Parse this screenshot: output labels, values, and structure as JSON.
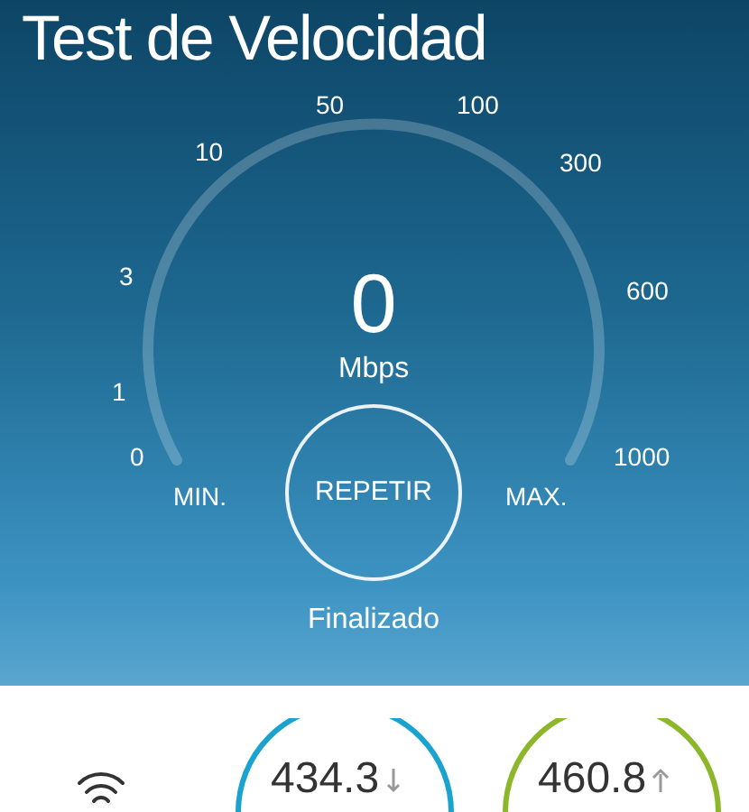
{
  "title": "Test de Velocidad",
  "gauge": {
    "scale": [
      "0",
      "1",
      "3",
      "10",
      "50",
      "100",
      "300",
      "600",
      "1000"
    ],
    "value": "0",
    "unit": "Mbps",
    "min_label": "MIN.",
    "max_label": "MAX.",
    "button": "REPETIR",
    "status": "Finalizado"
  },
  "results": [
    {
      "kind": "download",
      "value": "434.3",
      "color": "#1ba3d0"
    },
    {
      "kind": "upload",
      "value": "460.8",
      "color": "#8db72a"
    }
  ]
}
